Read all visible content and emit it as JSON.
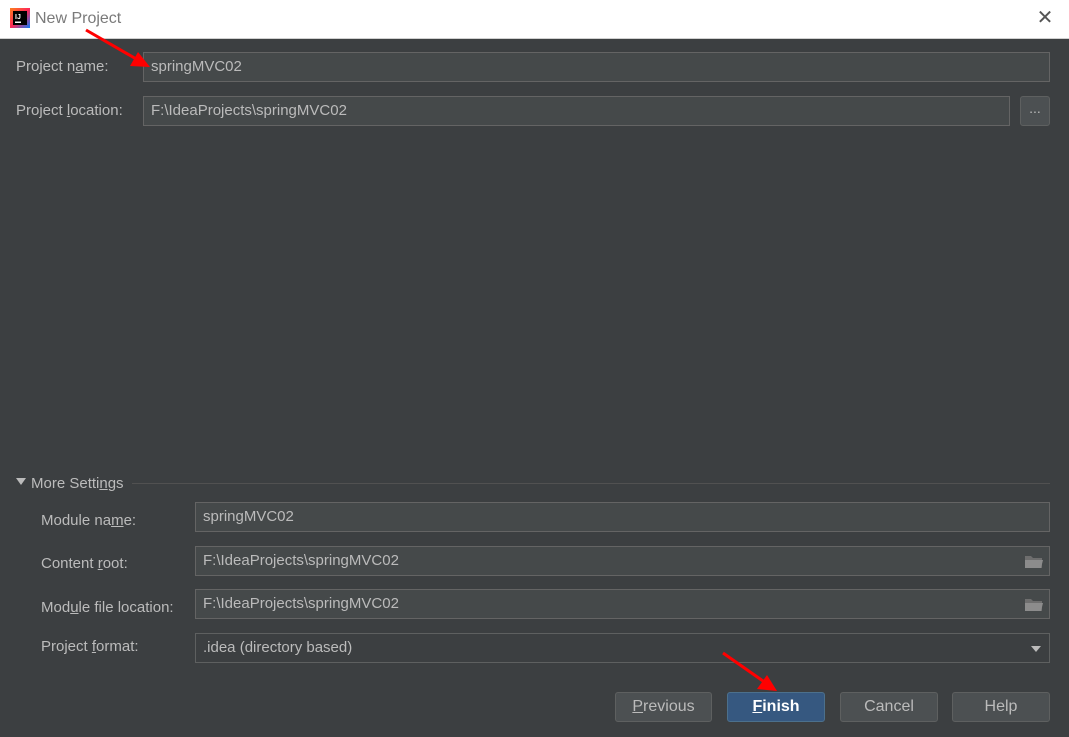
{
  "window": {
    "title": "New Project",
    "close_icon": "close-icon"
  },
  "project": {
    "name_label": "Project name:",
    "name_value": "springMVC02",
    "location_label": "Project location:",
    "location_value": "F:\\IdeaProjects\\springMVC02",
    "browse_label": "..."
  },
  "more_settings": {
    "header": "More Settings",
    "module_name_label": "Module name:",
    "module_name_value": "springMVC02",
    "content_root_label": "Content root:",
    "content_root_value": "F:\\IdeaProjects\\springMVC02",
    "module_file_location_label": "Module file location:",
    "module_file_location_value": "F:\\IdeaProjects\\springMVC02",
    "project_format_label": "Project format:",
    "project_format_value": ".idea (directory based)"
  },
  "buttons": {
    "previous": "Previous",
    "finish": "Finish",
    "cancel": "Cancel",
    "help": "Help"
  },
  "colors": {
    "background": "#3c3f41",
    "field_background": "#45494a",
    "primary_button": "#365880",
    "annotation_arrow": "#ff0000"
  }
}
